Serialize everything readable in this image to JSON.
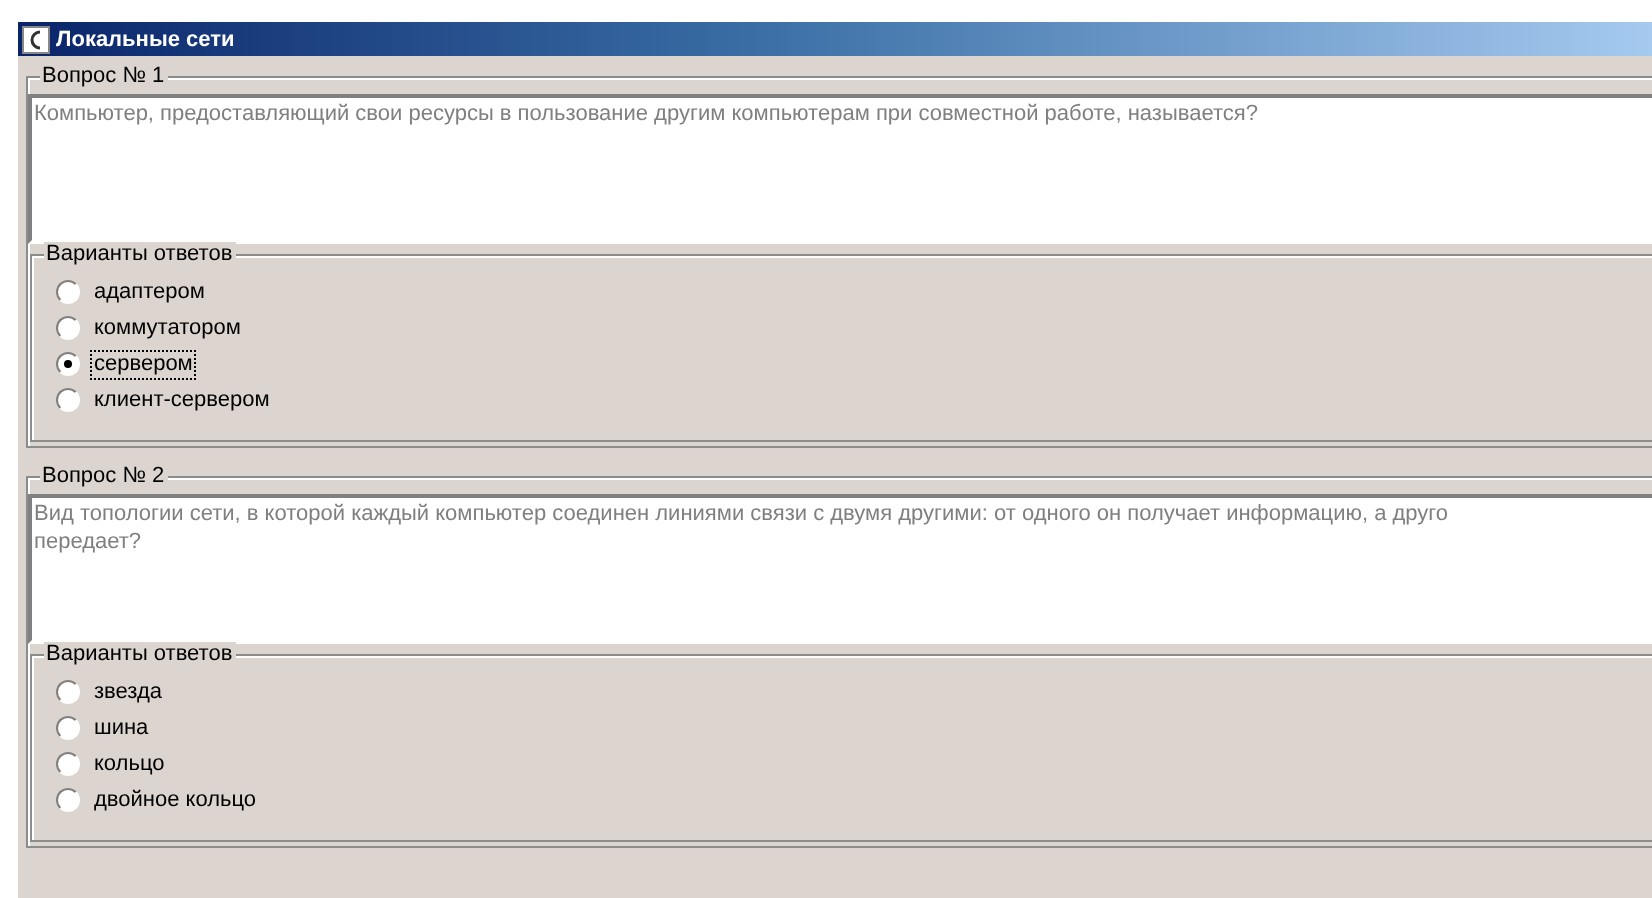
{
  "window": {
    "title": "Локальные сети"
  },
  "questions": [
    {
      "label": "Вопрос № 1",
      "text_lines": [
        "Компьютер, предоставляющий свои ресурсы в пользование другим компьютерам при совместной работе, называется?"
      ],
      "answers_label": "Варианты ответов",
      "answers": [
        {
          "label": "адаптером",
          "selected": false,
          "focused": false
        },
        {
          "label": "коммутатором",
          "selected": false,
          "focused": false
        },
        {
          "label": "сервером",
          "selected": true,
          "focused": true
        },
        {
          "label": "клиент-сервером",
          "selected": false,
          "focused": false
        }
      ]
    },
    {
      "label": "Вопрос № 2",
      "text_lines": [
        "Вид топологии сети, в которой каждый компьютер соединен линиями связи с двумя другими: от одного он получает информацию, а друго",
        "передает?"
      ],
      "answers_label": "Варианты ответов",
      "answers": [
        {
          "label": "звезда",
          "selected": false,
          "focused": false
        },
        {
          "label": "шина",
          "selected": false,
          "focused": false
        },
        {
          "label": "кольцо",
          "selected": false,
          "focused": false
        },
        {
          "label": "двойное кольцо",
          "selected": false,
          "focused": false
        }
      ]
    }
  ]
}
